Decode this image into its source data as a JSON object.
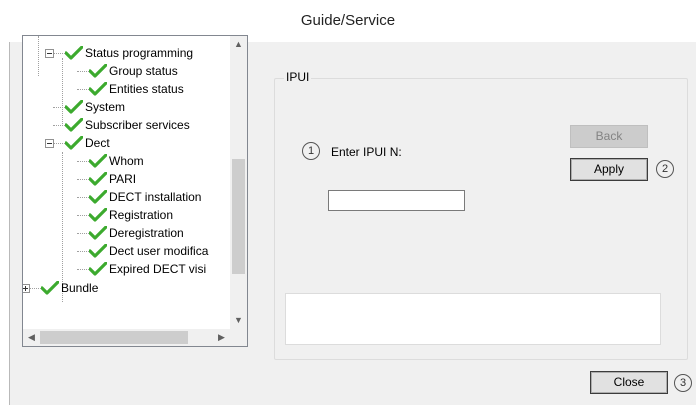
{
  "window": {
    "title": "Guide/Service"
  },
  "tree": {
    "items": [
      {
        "label": "Status programming",
        "expander": "minus"
      },
      {
        "label": "Group status"
      },
      {
        "label": "Entities status"
      },
      {
        "label": "System"
      },
      {
        "label": "Subscriber services"
      },
      {
        "label": "Dect",
        "expander": "minus"
      },
      {
        "label": "Whom"
      },
      {
        "label": "PARI"
      },
      {
        "label": "DECT installation"
      },
      {
        "label": "Registration"
      },
      {
        "label": "Deregistration"
      },
      {
        "label": "Dect user modifica"
      },
      {
        "label": "Expired DECT visi"
      },
      {
        "label": "Bundle",
        "expander": "plus"
      }
    ],
    "scroll_up": "▲",
    "scroll_down": "▼",
    "scroll_left": "◀",
    "scroll_right": "▶"
  },
  "ipui": {
    "group_label": "IPUI",
    "step1": "1",
    "enter_label": "Enter IPUI N:",
    "input_value": "",
    "back_label": "Back",
    "apply_label": "Apply",
    "step2": "2"
  },
  "footer": {
    "close_label": "Close",
    "step3": "3"
  },
  "icons": {
    "check": "green-checkmark-icon"
  },
  "colors": {
    "check_green": "#3caa2e",
    "window_bg": "#f0f0f0"
  }
}
